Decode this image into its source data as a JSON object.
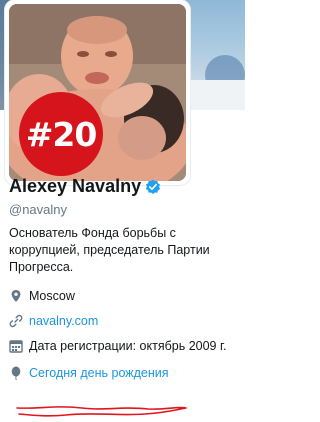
{
  "profile": {
    "name": "Alexey Navalny",
    "handle": "@navalny",
    "bio": "Основатель Фонда борьбы с коррупцией, председатель Партии Прогресса.",
    "location": "Moscow",
    "url": "navalny.com",
    "joined": "Дата регистрации: октябрь 2009 г.",
    "birthday": "Сегодня день рождения"
  },
  "avatar": {
    "badge_text": "#20"
  },
  "icons": {
    "verified": "verified-badge-icon",
    "location": "map-pin-icon",
    "url": "link-icon",
    "joined": "calendar-icon",
    "birthday": "balloon-icon"
  },
  "colors": {
    "link": "#1b95e0",
    "verified": "#1da1f2",
    "badge": "#d6141c",
    "annotation": "#e0161e",
    "secondary_text": "#657786"
  }
}
